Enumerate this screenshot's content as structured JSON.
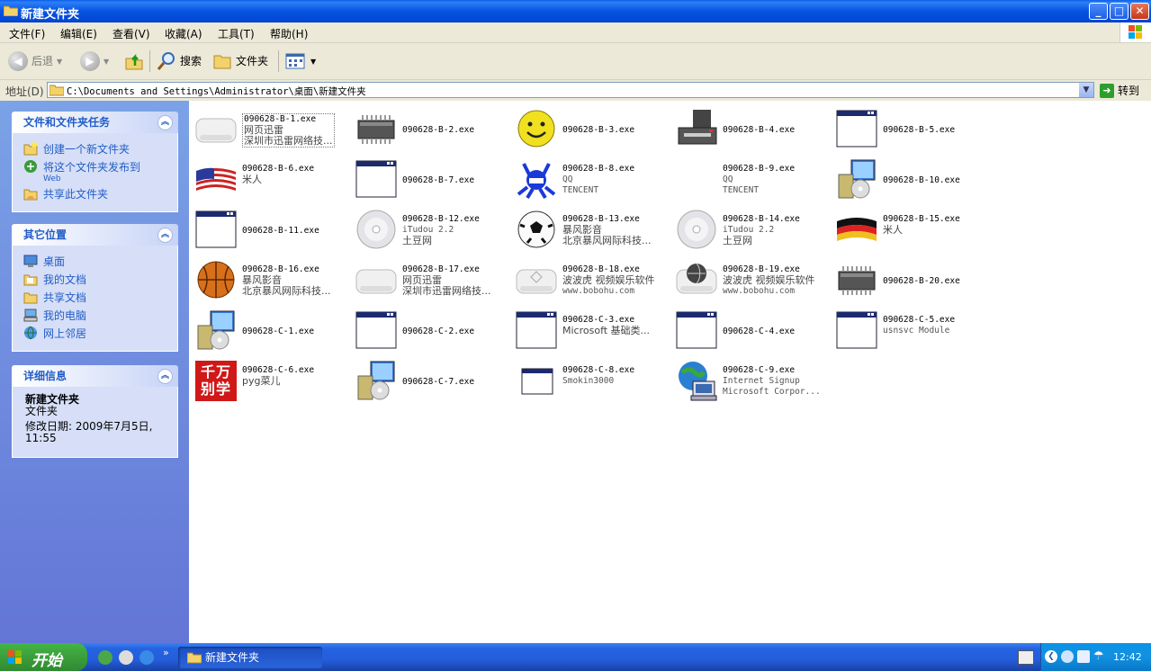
{
  "window": {
    "title": "新建文件夹",
    "controls": {
      "minimize": "_",
      "maximize": "□",
      "close": "✕"
    }
  },
  "menu": [
    "文件(F)",
    "编辑(E)",
    "查看(V)",
    "收藏(A)",
    "工具(T)",
    "帮助(H)"
  ],
  "toolbar": {
    "back": "后退",
    "search": "搜索",
    "folders": "文件夹"
  },
  "address": {
    "label": "地址(D)",
    "path": "C:\\Documents and Settings\\Administrator\\桌面\\新建文件夹",
    "go": "转到"
  },
  "sidebar": {
    "tasks": {
      "title": "文件和文件夹任务",
      "items": [
        {
          "label": "创建一个新文件夹",
          "sub": "",
          "icon": "new-folder-icon"
        },
        {
          "label": "将这个文件夹发布到",
          "sub": "Web",
          "icon": "publish-web-icon"
        },
        {
          "label": "共享此文件夹",
          "sub": "",
          "icon": "share-folder-icon"
        }
      ]
    },
    "places": {
      "title": "其它位置",
      "items": [
        {
          "label": "桌面",
          "icon": "desktop-icon"
        },
        {
          "label": "我的文档",
          "icon": "my-documents-icon"
        },
        {
          "label": "共享文档",
          "icon": "shared-documents-icon"
        },
        {
          "label": "我的电脑",
          "icon": "my-computer-icon"
        },
        {
          "label": "网上邻居",
          "icon": "network-places-icon"
        }
      ]
    },
    "details": {
      "title": "详细信息",
      "name": "新建文件夹",
      "type": "文件夹",
      "modified_line1": "修改日期: 2009年7月5日,",
      "modified_line2": "11:55"
    }
  },
  "files": [
    {
      "name": "090628-B-1.exe",
      "desc1": "网页迅雷",
      "desc2": "深圳市迅雷网络技...",
      "icon": "device-icon",
      "selected": true
    },
    {
      "name": "090628-B-2.exe",
      "desc1": "",
      "desc2": "",
      "icon": "chip-icon"
    },
    {
      "name": "090628-B-3.exe",
      "desc1": "",
      "desc2": "",
      "icon": "smiley-icon"
    },
    {
      "name": "090628-B-4.exe",
      "desc1": "",
      "desc2": "",
      "icon": "printer-icon"
    },
    {
      "name": "090628-B-5.exe",
      "desc1": "",
      "desc2": "",
      "icon": "window-icon"
    },
    {
      "name": "090628-B-6.exe",
      "desc1": "米人",
      "desc2": "",
      "icon": "us-flag-icon"
    },
    {
      "name": "090628-B-7.exe",
      "desc1": "",
      "desc2": "",
      "icon": "window-icon"
    },
    {
      "name": "090628-B-8.exe",
      "desc1": "QQ",
      "desc2": "TENCENT",
      "icon": "mascot-icon"
    },
    {
      "name": "090628-B-9.exe",
      "desc1": "QQ",
      "desc2": "TENCENT",
      "icon": "blank-icon"
    },
    {
      "name": "090628-B-10.exe",
      "desc1": "",
      "desc2": "",
      "icon": "installer-icon"
    },
    {
      "name": "090628-B-11.exe",
      "desc1": "",
      "desc2": "",
      "icon": "window-icon"
    },
    {
      "name": "090628-B-12.exe",
      "desc1": "iTudou 2.2",
      "desc2": "土豆网",
      "icon": "cd-icon"
    },
    {
      "name": "090628-B-13.exe",
      "desc1": "暴风影音",
      "desc2": "北京暴风网际科技...",
      "icon": "soccer-ball-icon"
    },
    {
      "name": "090628-B-14.exe",
      "desc1": "iTudou 2.2",
      "desc2": "土豆网",
      "icon": "cd-icon"
    },
    {
      "name": "090628-B-15.exe",
      "desc1": "米人",
      "desc2": "",
      "icon": "german-flag-icon"
    },
    {
      "name": "090628-B-16.exe",
      "desc1": "暴风影音",
      "desc2": "北京暴风网际科技...",
      "icon": "basketball-icon"
    },
    {
      "name": "090628-B-17.exe",
      "desc1": "网页迅雷",
      "desc2": "深圳市迅雷网络技...",
      "icon": "device-icon"
    },
    {
      "name": "090628-B-18.exe",
      "desc1": "波波虎 视频娱乐软件",
      "desc2": "www.bobohu.com",
      "icon": "device-diamond-icon"
    },
    {
      "name": "090628-B-19.exe",
      "desc1": "波波虎 视频娱乐软件",
      "desc2": "www.bobohu.com",
      "icon": "globe-device-icon"
    },
    {
      "name": "090628-B-20.exe",
      "desc1": "",
      "desc2": "",
      "icon": "chip-icon"
    },
    {
      "name": "090628-C-1.exe",
      "desc1": "",
      "desc2": "",
      "icon": "installer-icon"
    },
    {
      "name": "090628-C-2.exe",
      "desc1": "",
      "desc2": "",
      "icon": "window-icon"
    },
    {
      "name": "090628-C-3.exe",
      "desc1": "Microsoft 基础类...",
      "desc2": "",
      "icon": "window-icon"
    },
    {
      "name": "090628-C-4.exe",
      "desc1": "",
      "desc2": "",
      "icon": "window-icon"
    },
    {
      "name": "090628-C-5.exe",
      "desc1": "usnsvc Module",
      "desc2": "",
      "icon": "window-icon"
    },
    {
      "name": "090628-C-6.exe",
      "desc1": "pyg菜儿",
      "desc2": "",
      "icon": "red-badge-icon",
      "badge": "千万别学"
    },
    {
      "name": "090628-C-7.exe",
      "desc1": "",
      "desc2": "",
      "icon": "installer-icon"
    },
    {
      "name": "090628-C-8.exe",
      "desc1": "Smokin3000",
      "desc2": "",
      "icon": "small-window-icon"
    },
    {
      "name": "090628-C-9.exe",
      "desc1": "Internet Signup",
      "desc2": "Microsoft Corpor...",
      "icon": "internet-signup-icon"
    }
  ],
  "taskbar": {
    "start": "开始",
    "window_button": "新建文件夹",
    "clock": "12:42"
  },
  "colors": {
    "titlebar": "#0553e0",
    "sidebar_bg": "#7ba2e7",
    "link": "#215dc6",
    "start_green": "#3c9e3c"
  }
}
